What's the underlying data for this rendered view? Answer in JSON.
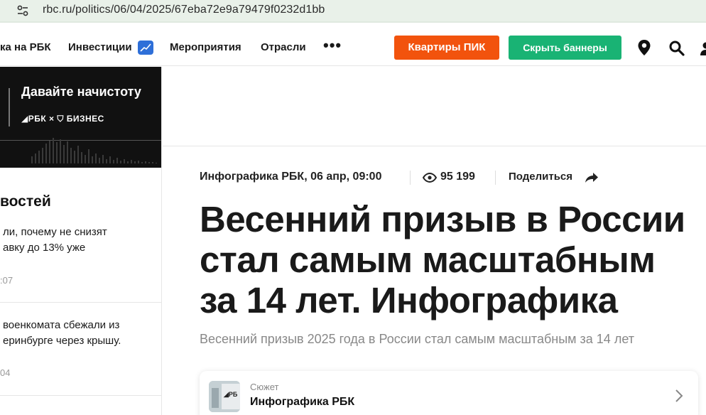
{
  "browser": {
    "url": "rbc.ru/politics/06/04/2025/67eba72e9a79479f0232d1bb",
    "site_info_icon": "tune-icon"
  },
  "nav": {
    "items": [
      {
        "label": "ка на РБК"
      },
      {
        "label": "Инвестиции"
      },
      {
        "label": "Мероприятия"
      },
      {
        "label": "Отрасли"
      }
    ],
    "more_label": "•••",
    "pik_label": "Квартиры ПИК",
    "hide_banners_label": "Скрыть баннеры",
    "icons": [
      "location-pin-icon",
      "search-icon",
      "user-icon"
    ],
    "colors": {
      "pik": "#f2530d",
      "hide_banners": "#19b374"
    }
  },
  "sidebar": {
    "promo": {
      "title": "Давайте начистоту",
      "brand": "◢РБК × ⛉ БИЗНЕС"
    },
    "heading": "востей",
    "news": [
      {
        "text": "ли, почему не снизят\nавку до 13% уже",
        "time": ":07"
      },
      {
        "text": "военкомата сбежали из\nеринбурге через крышу.",
        "time": "04"
      }
    ]
  },
  "article": {
    "source_date": "Инфографика РБК, 06 апр, 09:00",
    "views": "95 199",
    "share_label": "Поделиться",
    "title": "Весенний призыв в России стал самым масштабным за 14 лет. Инфографика",
    "subtitle": "Весенний призыв 2025 года в России стал самым масштабным за 14 лет",
    "story": {
      "kicker": "Сюжет",
      "title": "Инфографика РБК"
    }
  }
}
